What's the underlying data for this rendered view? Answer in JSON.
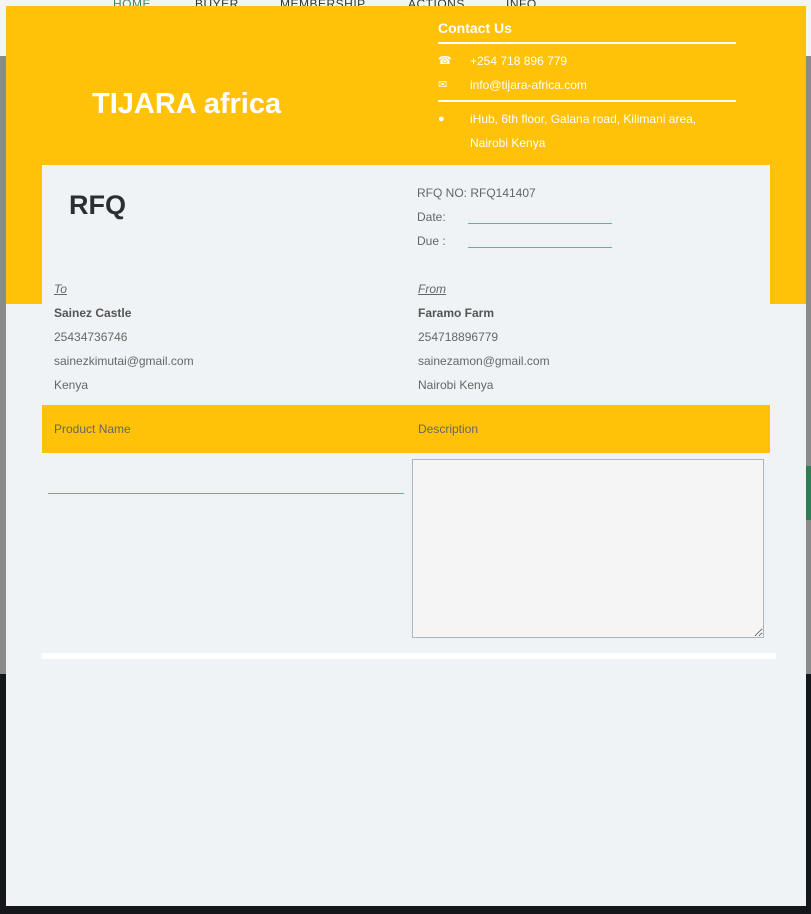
{
  "background_nav": [
    "HOME",
    "BUYER",
    "MEMBERSHIP",
    "ACTIONS",
    "INFO"
  ],
  "brand": {
    "name": "TIJARA africa"
  },
  "contact": {
    "title": "Contact Us",
    "phone": "+254 718 896 779",
    "email": "info@tijara-africa.com",
    "address": "iHub, 6th floor, Galana road, Kilimani area, Nairobi Kenya",
    "icons": {
      "phone": "phone-icon",
      "email": "envelope-icon",
      "address": "map-marker-icon"
    }
  },
  "rfq": {
    "title": "RFQ",
    "number_label": "RFQ NO: RFQ141407",
    "date_label": "Date:",
    "date_value": "",
    "due_label": "Due :",
    "due_value": ""
  },
  "to": {
    "label": "To",
    "name": "Sainez Castle",
    "phone": "25434736746",
    "email": "sainezkimutai@gmail.com",
    "location": "Kenya"
  },
  "from": {
    "label": "From",
    "name": "Faramo Farm",
    "phone": "254718896779",
    "email": "sainezamon@gmail.com",
    "location": "Nairobi Kenya"
  },
  "table": {
    "headers": [
      "Product Name",
      "Description"
    ],
    "product_value": "",
    "description_value": ""
  },
  "colors": {
    "accent": "#ffc208",
    "panel": "#eff3f6",
    "input_line": "#5ab98a"
  }
}
